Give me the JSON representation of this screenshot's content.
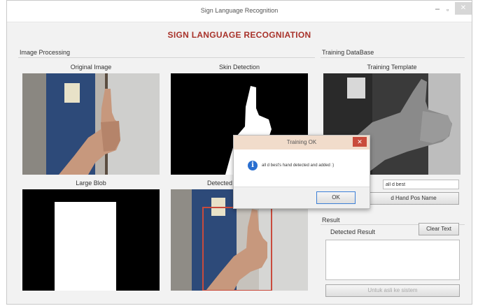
{
  "window": {
    "title": "Sign Language Recognition",
    "min_glyph": "–",
    "max_glyph": "▫",
    "close_glyph": "✕"
  },
  "app_title": "SIGN LANGUAGE RECOGNIATION",
  "image_processing": {
    "group_label": "Image Processing",
    "panels": {
      "original": "Original Image",
      "skin": "Skin Detection",
      "blob": "Large Blob",
      "detected": "Detected"
    }
  },
  "training": {
    "group_label": "Training DataBase",
    "template_label": "Training Template",
    "hand_name_value": "all d best",
    "hand_pos_button": "d Hand Pos Name"
  },
  "result": {
    "group_label": "Result",
    "detected_label": "Detected Result",
    "clear_button": "Clear Text",
    "bottom_button": "Untuk asli ke sistem"
  },
  "dialog": {
    "title": "Training OK",
    "close_glyph": "✕",
    "info_glyph": "i",
    "message": "all d best's hand detected and added :)",
    "ok_label": "OK"
  },
  "icons": {
    "info": "info-icon",
    "close": "close-icon",
    "minimize": "minimize-icon",
    "maximize": "maximize-icon"
  },
  "colors": {
    "title_accent": "#a8322a",
    "dialog_title_bg": "#f1dccb",
    "dialog_close": "#c94b3c",
    "info_blue": "#2a6fd0"
  }
}
